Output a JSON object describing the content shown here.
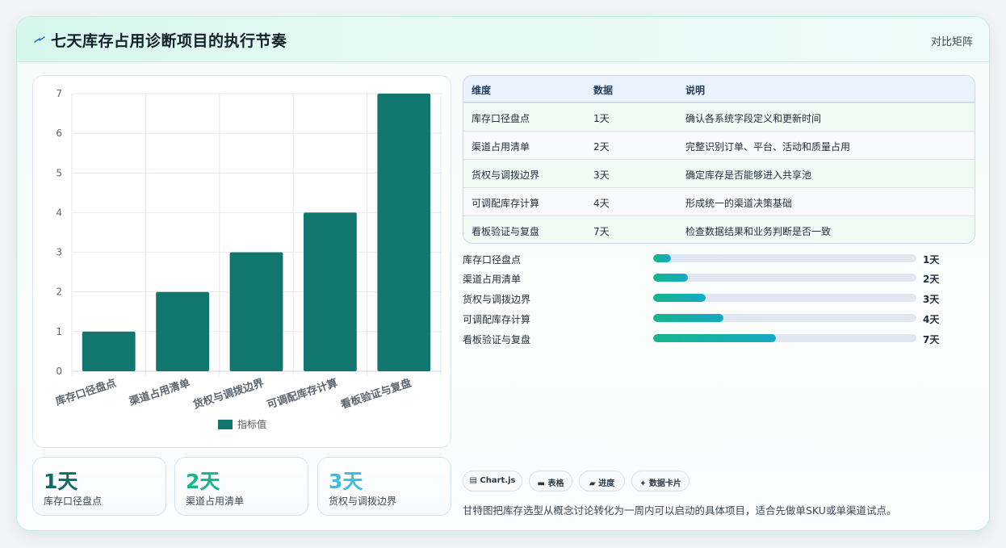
{
  "header": {
    "title": "七天库存占用诊断项目的执行节奏",
    "compare_label": "对比矩阵",
    "accent": "#1bb394"
  },
  "chart_data": {
    "type": "bar",
    "categories": [
      "库存口径盘点",
      "渠道占用清单",
      "货权与调拨边界",
      "可调配库存计算",
      "看板验证与复盘"
    ],
    "series": [
      {
        "name": "指标值",
        "values": [
          1,
          2,
          3,
          4,
          7
        ],
        "color": "#11766e"
      }
    ],
    "ylim": [
      0,
      7
    ],
    "yticks": [
      0,
      1,
      2,
      3,
      4,
      5,
      6,
      7
    ],
    "grid": true,
    "legend": "bottom"
  },
  "table": {
    "headers": [
      "维度",
      "数据",
      "说明"
    ],
    "rows": [
      [
        "库存口径盘点",
        "1天",
        "确认各系统字段定义和更新时间"
      ],
      [
        "渠道占用清单",
        "2天",
        "完整识别订单、平台、活动和质量占用"
      ],
      [
        "货权与调拨边界",
        "3天",
        "确定库存是否能够进入共享池"
      ],
      [
        "可调配库存计算",
        "4天",
        "形成统一的渠道决策基础"
      ],
      [
        "看板验证与复盘",
        "7天",
        "检查数据结果和业务判断是否一致"
      ]
    ]
  },
  "progress": {
    "max": 15,
    "items": [
      {
        "label": "库存口径盘点",
        "value": 1,
        "display": "1天"
      },
      {
        "label": "渠道占用清单",
        "value": 2,
        "display": "2天"
      },
      {
        "label": "货权与调拨边界",
        "value": 3,
        "display": "3天"
      },
      {
        "label": "可调配库存计算",
        "value": 4,
        "display": "4天"
      },
      {
        "label": "看板验证与复盘",
        "value": 7,
        "display": "7天"
      }
    ]
  },
  "kpis": [
    {
      "value": "1天",
      "label": "库存口径盘点",
      "color": "#0f6e64"
    },
    {
      "value": "2天",
      "label": "渠道占用清单",
      "color": "#16b58c"
    },
    {
      "value": "3天",
      "label": "货权与调拨边界",
      "color": "#3dbbe3"
    }
  ],
  "chips": [
    {
      "icon": "chart-icon",
      "label": "Chart.js"
    },
    {
      "icon": "table-icon",
      "label": "表格"
    },
    {
      "icon": "progress-icon",
      "label": "进度"
    },
    {
      "icon": "card-icon",
      "label": "数据卡片"
    }
  ],
  "footer": {
    "text": "甘特图把库存选型从概念讨论转化为一周内可以启动的具体项目，适合先做单SKU或单渠道试点。"
  }
}
